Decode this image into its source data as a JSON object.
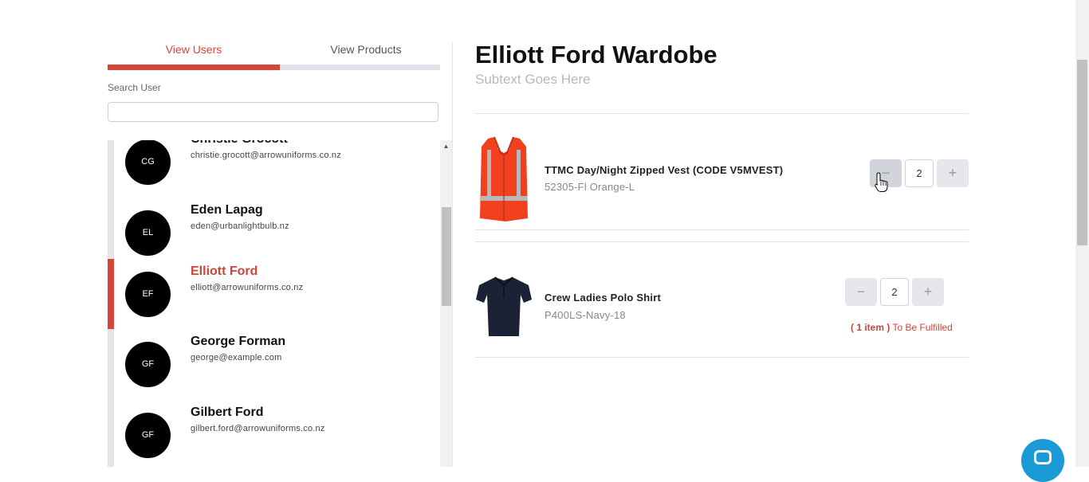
{
  "tabs": {
    "users": "View Users",
    "products": "View Products"
  },
  "search": {
    "label": "Search User",
    "value": "",
    "placeholder": ""
  },
  "users": [
    {
      "initials": "CG",
      "name": "Christie Grocott",
      "email": "christie.grocott@arrowuniforms.co.nz"
    },
    {
      "initials": "EL",
      "name": "Eden Lapag",
      "email": "eden@urbanlightbulb.nz"
    },
    {
      "initials": "EF",
      "name": "Elliott Ford",
      "email": "elliott@arrowuniforms.co.nz"
    },
    {
      "initials": "GF",
      "name": "George Forman",
      "email": "george@example.com"
    },
    {
      "initials": "GF",
      "name": "Gilbert Ford",
      "email": "gilbert.ford@arrowuniforms.co.nz"
    }
  ],
  "wardrobe": {
    "title": "Elliott Ford Wardobe",
    "subtitle": "Subtext Goes Here",
    "products": [
      {
        "name": "TTMC Day/Night Zipped Vest (CODE V5MVEST)",
        "sku": "52305-Fl Orange-L",
        "quantity": "2",
        "minus": "−",
        "plus": "+"
      },
      {
        "name": "Crew Ladies Polo Shirt",
        "sku": "P400LS-Navy-18",
        "quantity": "2",
        "minus": "−",
        "plus": "+",
        "fulfil_count": "( 1 item )",
        "fulfil_text": " To Be Fulfilled"
      }
    ]
  },
  "colors": {
    "accent": "#d6453a",
    "chat": "#1a9ad6",
    "vest": "#f0401e",
    "polo": "#1b2236"
  },
  "icons": {
    "chat": "chat-icon",
    "cursor": "hand-pointer-icon",
    "scroll_up": "scroll-up-arrow-icon"
  }
}
